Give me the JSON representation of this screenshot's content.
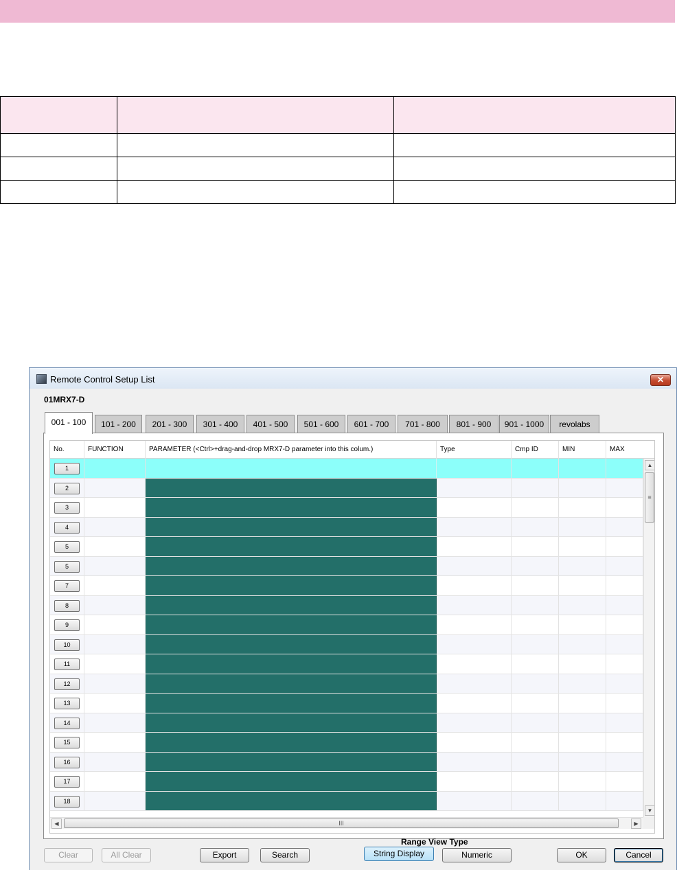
{
  "window": {
    "title": "Remote Control Setup List",
    "close_glyph": "✕",
    "device": "01MRX7-D"
  },
  "tabs": [
    "001 - 100",
    "101 - 200",
    "201 - 300",
    "301 - 400",
    "401 - 500",
    "501 - 600",
    "601 - 700",
    "701 - 800",
    "801 - 900",
    "901 - 1000",
    "revolabs"
  ],
  "active_tab": "001 - 100",
  "grid": {
    "headers": {
      "no": "No.",
      "function": "FUNCTION",
      "parameter": "PARAMETER (<Ctrl>+drag-and-drop MRX7-D parameter into this colum.)",
      "type": "Type",
      "cmp_id": "Cmp ID",
      "min": "MIN",
      "max": "MAX"
    },
    "row_labels": [
      "1",
      "2",
      "3",
      "4",
      "5",
      "5",
      "7",
      "8",
      "9",
      "10",
      "11",
      "12",
      "13",
      "14",
      "15",
      "16",
      "17",
      "18"
    ],
    "selected_row": 1,
    "param_cell_color": "#236f69",
    "selected_row_color": "#8cfffa"
  },
  "scrollbars": {
    "up_glyph": "▲",
    "down_glyph": "▼",
    "left_glyph": "◀",
    "right_glyph": "▶",
    "v_grip": "≡",
    "h_grip": "III"
  },
  "buttons": {
    "clear": "Clear",
    "all_clear": "All Clear",
    "export": "Export",
    "search": "Search",
    "range_view_type_label": "Range View Type",
    "string_display": "String Display",
    "numeric": "Numeric",
    "ok": "OK",
    "cancel": "Cancel"
  },
  "colors": {
    "header_band": "#efb9d3",
    "table_header": "#fbe6ef"
  }
}
